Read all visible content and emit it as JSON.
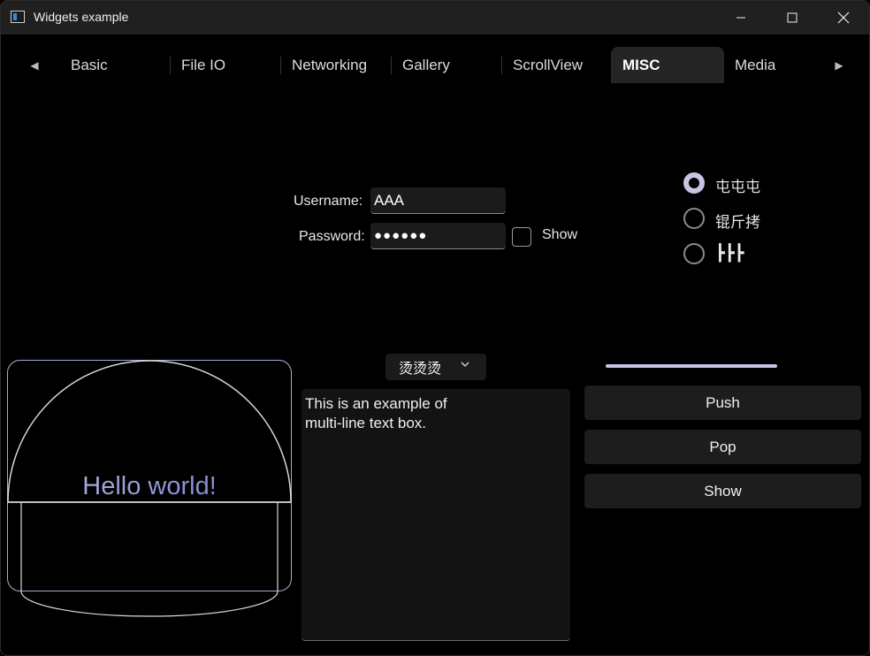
{
  "window": {
    "title": "Widgets example"
  },
  "tabs": [
    {
      "label": "Basic"
    },
    {
      "label": "File IO"
    },
    {
      "label": "Networking"
    },
    {
      "label": "Gallery"
    },
    {
      "label": "ScrollView"
    },
    {
      "label": "MISC",
      "active": true
    },
    {
      "label": "Media"
    }
  ],
  "form": {
    "username_label": "Username:",
    "username_value": "AAA",
    "password_label": "Password:",
    "password_value": "●●●●●●",
    "show_label": "Show"
  },
  "radios": [
    {
      "label": "屯屯屯",
      "checked": true
    },
    {
      "label": "锟斤拷",
      "checked": false
    },
    {
      "label": "┣┣┣",
      "checked": false
    }
  ],
  "combo": {
    "value": "烫烫烫"
  },
  "slider": {
    "value_fraction": 1.0
  },
  "textbox": {
    "text": "This is an example of\nmulti-line text box."
  },
  "buttons": {
    "push": "Push",
    "pop": "Pop",
    "show": "Show"
  },
  "canvas": {
    "text": "Hello world!"
  },
  "colors": {
    "accent": "#c7c3e3",
    "canvas_border": "#9fb4cc"
  }
}
